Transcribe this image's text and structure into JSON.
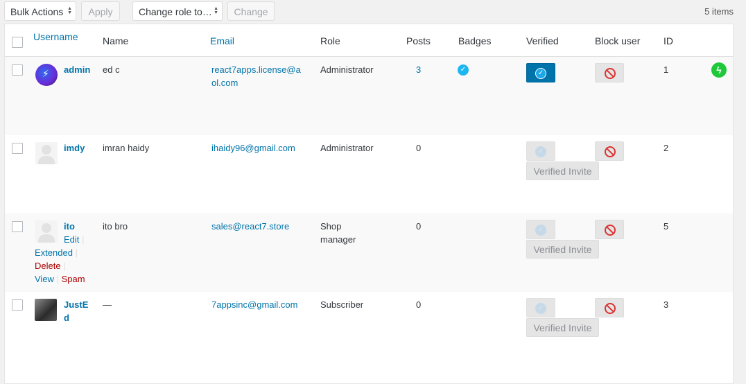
{
  "toolbar": {
    "bulk_actions": "Bulk Actions",
    "apply": "Apply",
    "change_role": "Change role to…",
    "change": "Change",
    "items_count": "5 items"
  },
  "columns": {
    "username": "Username",
    "name": "Name",
    "email": "Email",
    "role": "Role",
    "posts": "Posts",
    "badges": "Badges",
    "verified": "Verified",
    "block_user": "Block user",
    "id": "ID"
  },
  "rows": [
    {
      "username": "admin",
      "name": "ed c",
      "email": "react7apps.license@aol.com",
      "role": "Administrator",
      "posts": "3",
      "id": "1",
      "verified": true,
      "has_badge": true
    },
    {
      "username": "imdy",
      "name": "imran haidy",
      "email": "ihaidy96@gmail.com",
      "role": "Administrator",
      "posts": "0",
      "id": "2",
      "verified": false,
      "invite": "Verified Invite"
    },
    {
      "username": "ito",
      "name": "ito bro",
      "email": "sales@react7.store",
      "role": "Shop manager",
      "posts": "0",
      "id": "5",
      "verified": false,
      "invite": "Verified Invite",
      "actions": {
        "edit": "Edit",
        "extended": "Extended",
        "delete": "Delete",
        "view": "View",
        "spam": "Spam"
      }
    },
    {
      "username": "JustEd",
      "name": "—",
      "email": "7appsinc@gmail.com",
      "role": "Subscriber",
      "posts": "0",
      "id": "3",
      "verified": false,
      "invite": "Verified Invite"
    }
  ],
  "colors": {
    "link": "#0073aa",
    "verified_on": "#0073aa",
    "badge": "#1eb6f0",
    "block": "#dc3232",
    "bolt": "#1ec83a"
  },
  "icons": {
    "badge": "check-badge-icon",
    "block": "no-entry-icon",
    "status": "lightning-icon"
  }
}
